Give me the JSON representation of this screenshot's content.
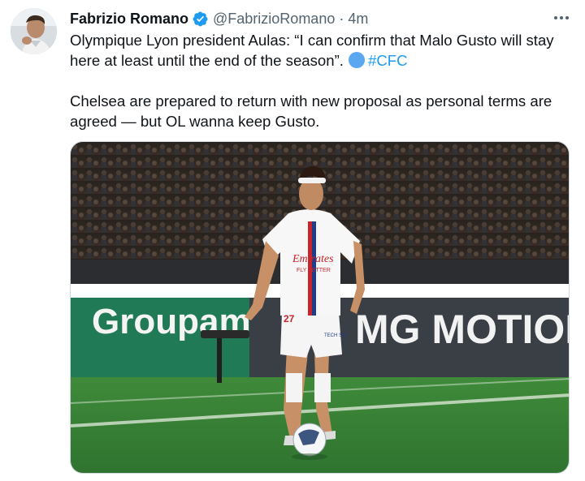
{
  "author": {
    "name": "Fabrizio Romano",
    "handle": "@FabrizioRomano",
    "separator": "·",
    "time": "4m",
    "verified_icon": "verified-badge-icon"
  },
  "tweet": {
    "line1": "Olympique Lyon president Aulas: “I can confirm that Malo Gusto will stay here at least until the end of the season”.",
    "emoji": "blue-circle-emoji",
    "hashtag": "#CFC",
    "line2": "Chelsea are prepared to return with new proposal as personal terms are agreed — but OL wanna keep Gusto."
  },
  "media": {
    "board_left": "Groupama",
    "board_right": "MG MOTION",
    "shirt_sponsor_1": "Emirates",
    "shirt_sponsor_2": "FLY BETTER",
    "shirt_number": "27",
    "short_sponsor": "TECH SKY"
  },
  "colors": {
    "accent": "#1d9bf0",
    "secondary_text": "#536471",
    "primary_text": "#0f1419"
  }
}
